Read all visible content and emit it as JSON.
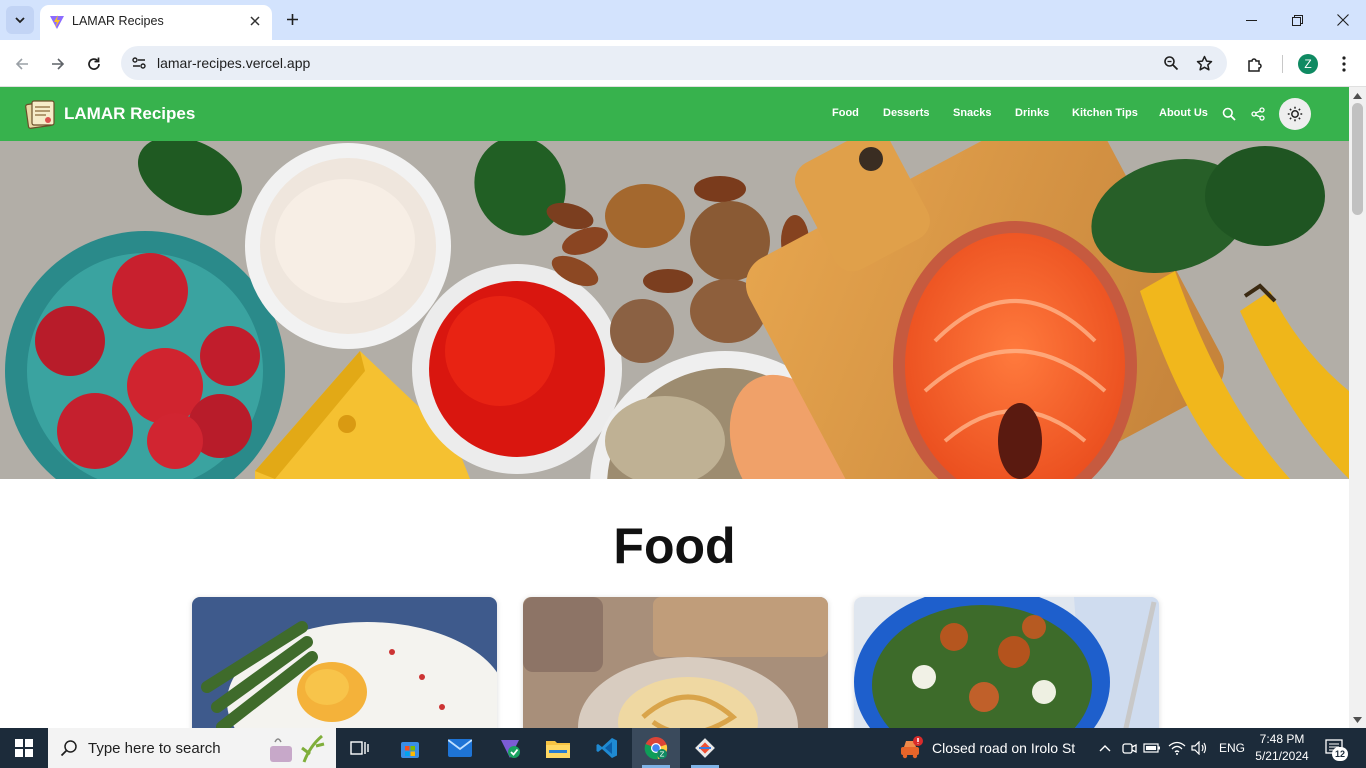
{
  "browser": {
    "tab_title": "LAMAR Recipes",
    "url": "lamar-recipes.vercel.app",
    "profile_initial": "Z",
    "icons": [
      "tab-list-icon",
      "close-tab-icon",
      "new-tab-icon",
      "minimize-icon",
      "restore-icon",
      "close-window-icon",
      "back-icon",
      "forward-icon",
      "reload-icon",
      "site-info-icon",
      "zoom-icon",
      "bookmark-star-icon",
      "extensions-icon",
      "menu-kebab-icon"
    ]
  },
  "site": {
    "brand": "LAMAR Recipes",
    "nav": [
      "Food",
      "Desserts",
      "Snacks",
      "Drinks",
      "Kitchen Tips",
      "About Us"
    ],
    "nav_colors": {
      "background": "#37b24d",
      "text": "#ffffff"
    },
    "section_title": "Food",
    "hero_icon": "healthy-food-banner-image",
    "cards": [
      {
        "image": "fried-egg-asparagus-image"
      },
      {
        "image": "pastry-rolls-image"
      },
      {
        "image": "chicken-salad-bowl-image"
      }
    ]
  },
  "taskbar": {
    "search_placeholder": "Type here to search",
    "news": "Closed road on Irolo St",
    "language": "ENG",
    "time": "7:48 PM",
    "date": "5/21/2024",
    "notifications": "12"
  }
}
